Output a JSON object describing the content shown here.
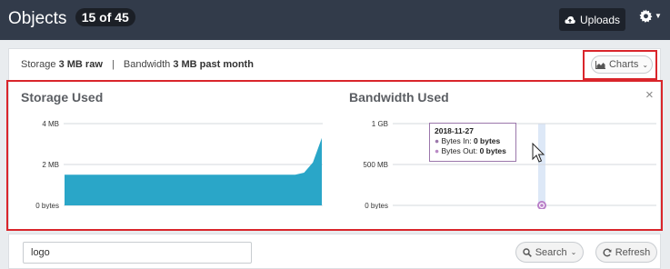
{
  "header": {
    "title": "Objects",
    "count_badge": "15 of 45",
    "uploads_label": "Uploads"
  },
  "summary": {
    "storage_label": "Storage",
    "storage_value": "3 MB raw",
    "separator": "|",
    "bandwidth_label": "Bandwidth",
    "bandwidth_value": "3 MB past month",
    "charts_button_label": "Charts"
  },
  "charts_panel": {
    "close_glyph": "×"
  },
  "tooltip": {
    "date": "2018-11-27",
    "bytes_in_label": "Bytes In:",
    "bytes_in_value": "0 bytes",
    "bytes_out_label": "Bytes Out:",
    "bytes_out_value": "0 bytes"
  },
  "search": {
    "input_value": "logo",
    "search_button_label": "Search",
    "refresh_button_label": "Refresh"
  },
  "colors": {
    "header_bg": "#323b4a",
    "storage_fill": "#2aa6c8",
    "bandwidth_highlight": "#dde8f7",
    "bandwidth_marker": "#b97fc8",
    "highlight_border": "#d9252b"
  },
  "chart_data": [
    {
      "type": "area",
      "title": "Storage Used",
      "xlabel": "",
      "ylabel": "",
      "yticks": [
        "0 bytes",
        "2 MB",
        "4 MB"
      ],
      "ylim": [
        0,
        4
      ],
      "y_unit": "MB",
      "x": [
        0,
        1,
        2,
        3,
        4,
        5,
        6,
        7,
        8,
        9,
        10,
        11,
        12,
        13,
        14,
        15,
        16,
        17,
        18,
        19,
        20,
        21,
        22,
        23,
        24,
        25,
        26,
        27,
        28,
        29
      ],
      "values": [
        1.5,
        1.5,
        1.5,
        1.5,
        1.5,
        1.5,
        1.5,
        1.5,
        1.5,
        1.5,
        1.5,
        1.5,
        1.5,
        1.5,
        1.5,
        1.5,
        1.5,
        1.5,
        1.5,
        1.5,
        1.5,
        1.5,
        1.5,
        1.5,
        1.5,
        1.5,
        1.5,
        1.6,
        2.1,
        3.3
      ],
      "grid": true
    },
    {
      "type": "line",
      "title": "Bandwidth Used",
      "xlabel": "",
      "ylabel": "",
      "yticks": [
        "0 bytes",
        "500 MB",
        "1 GB"
      ],
      "ylim": [
        0,
        1000
      ],
      "y_unit": "MB",
      "series": [
        {
          "name": "Bytes In",
          "values": [
            0
          ]
        },
        {
          "name": "Bytes Out",
          "values": [
            0
          ]
        }
      ],
      "x": [
        "2018-11-27"
      ],
      "grid": true
    }
  ]
}
